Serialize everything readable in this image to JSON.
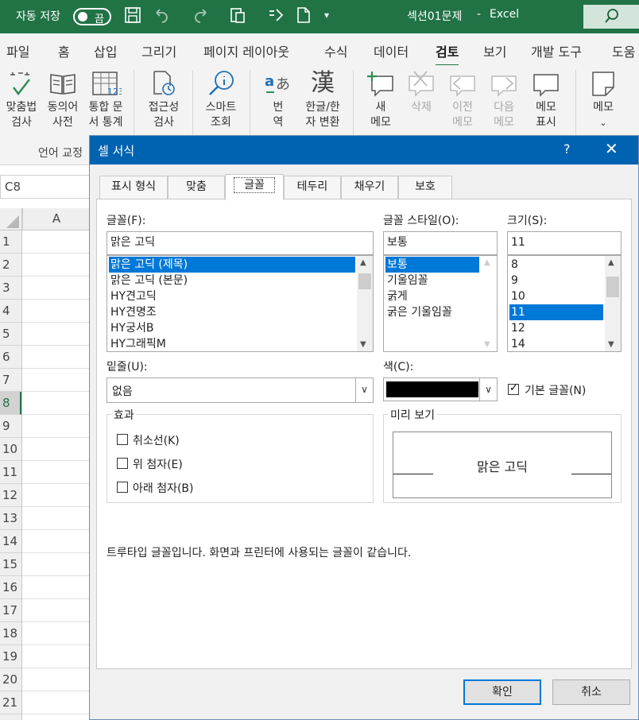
{
  "titlebar": {
    "autosave_label": "자동 저장",
    "autosave_state": "끔",
    "filename": "섹션01문제",
    "separator": "-",
    "app": "Excel"
  },
  "menu": {
    "tabs": [
      "파일",
      "홈",
      "삽입",
      "그리기",
      "페이지 레이아웃",
      "수식",
      "데이터",
      "검토",
      "보기",
      "개발 도구",
      "도움"
    ],
    "active": "검토"
  },
  "ribbon": {
    "spelling": [
      "맞춤법",
      "검사"
    ],
    "thesaurus": [
      "동의어",
      "사전"
    ],
    "workbook_stats": [
      "통합 문",
      "서 통계"
    ],
    "accessibility": [
      "접근성",
      "검사"
    ],
    "smart_lookup": [
      "스마트",
      "조회"
    ],
    "translate": [
      "번",
      "역"
    ],
    "hanja": [
      "한글/한",
      "자 변환"
    ],
    "new_comment": [
      "새",
      "메모"
    ],
    "delete_comment": [
      "삭제"
    ],
    "prev_comment": [
      "이전",
      "메모"
    ],
    "next_comment": [
      "다음",
      "메모"
    ],
    "show_comments": [
      "메모",
      "표시"
    ],
    "notes": [
      "메모"
    ],
    "group_proofing": "언어 교정"
  },
  "sheet": {
    "namebox": "C8",
    "column_a": "A",
    "rows": [
      "1",
      "2",
      "3",
      "4",
      "5",
      "6",
      "7",
      "8",
      "9",
      "10",
      "11",
      "12",
      "13",
      "14",
      "15",
      "16",
      "17",
      "18",
      "19",
      "20",
      "21"
    ],
    "selected_row": "8"
  },
  "dialog": {
    "title": "셀 서식",
    "help": "?",
    "close": "✕",
    "tabs": [
      "표시 형식",
      "맞춤",
      "글꼴",
      "테두리",
      "채우기",
      "보호"
    ],
    "active_tab": "글꼴",
    "font_label": "글꼴(F):",
    "font_value": "맑은 고딕",
    "font_list": [
      "맑은 고딕 (제목)",
      "맑은 고딕 (본문)",
      "HY견고딕",
      "HY견명조",
      "HY궁서B",
      "HY그래픽M"
    ],
    "style_label": "글꼴 스타일(O):",
    "style_value": "보통",
    "style_list": [
      "보통",
      "기울임꼴",
      "굵게",
      "굵은 기울임꼴"
    ],
    "size_label": "크기(S):",
    "size_value": "11",
    "size_list": [
      "8",
      "9",
      "10",
      "11",
      "12",
      "14"
    ],
    "underline_label": "밑줄(U):",
    "underline_value": "없음",
    "color_label": "색(C):",
    "color_value": "#000000",
    "default_font_label": "기본 글꼴(N)",
    "effects_label": "효과",
    "strikethrough": "취소선(K)",
    "superscript": "위 첨자(E)",
    "subscript": "아래 첨자(B)",
    "preview_label": "미리 보기",
    "preview_text": "맑은 고딕",
    "info_text": "트루타입 글꼴입니다. 화면과 프린터에 사용되는 글꼴이 같습니다.",
    "ok": "확인",
    "cancel": "취소"
  }
}
